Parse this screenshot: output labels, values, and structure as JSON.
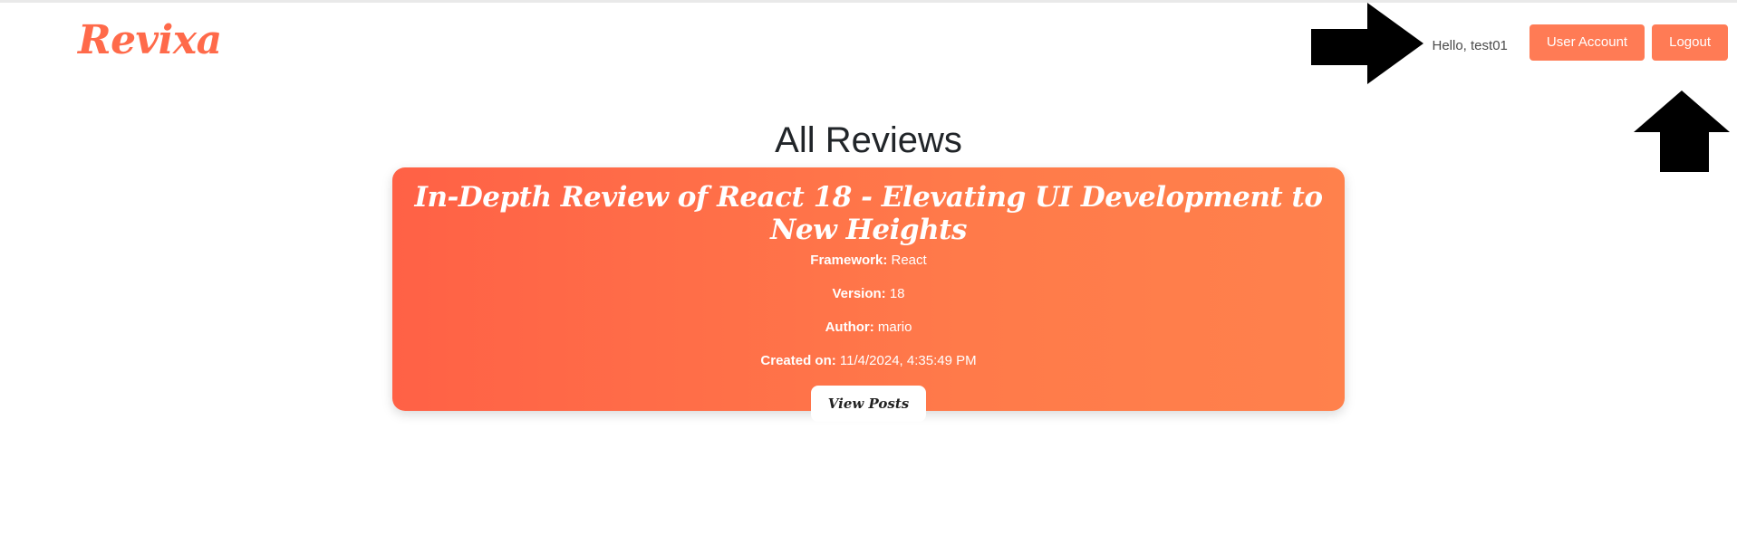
{
  "navbar": {
    "brand": "Revixa",
    "greeting": "Hello, test01",
    "user_account_label": "User Account",
    "logout_label": "Logout"
  },
  "page": {
    "title": "All Reviews"
  },
  "reviews": [
    {
      "title": "In-Depth Review of React 18 - Elevating UI Development to New Heights",
      "framework_label": "Framework:",
      "framework": "React",
      "version_label": "Version:",
      "version": "18",
      "author_label": "Author:",
      "author": "mario",
      "created_label": "Created on:",
      "created": "11/4/2024, 4:35:49 PM",
      "view_posts_label": "View Posts"
    }
  ],
  "annotations": {
    "arrow_color": "#000000",
    "arrow_right_icon": "arrow-right-icon",
    "arrow_up_icon": "arrow-up-icon"
  },
  "colors": {
    "brand": "#ff6a4a",
    "accent_button": "#ff7b55",
    "card_gradient_start": "#ff6146",
    "card_gradient_end": "#ff814c"
  }
}
